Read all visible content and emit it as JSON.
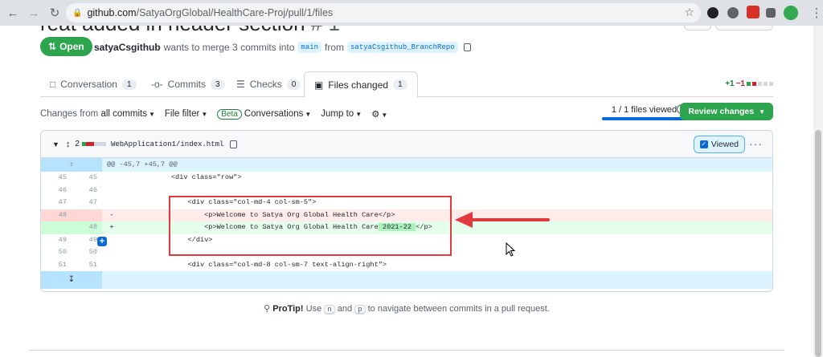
{
  "browser": {
    "url_host": "github.com",
    "url_path": "/SatyaOrgGlobal/HealthCare-Proj/pull/1/files"
  },
  "pr": {
    "title_fragment": "reat added in header section",
    "number_fragment": "# 1",
    "state": "Open",
    "author": "satyaCsgithub",
    "merge_text": "wants to merge 3 commits into",
    "base_branch": "main",
    "from_text": "from",
    "head_branch": "satyaCsgithub_BranchRepo"
  },
  "tabs": [
    {
      "label": "Conversation",
      "count": "1"
    },
    {
      "label": "Commits",
      "count": "3"
    },
    {
      "label": "Checks",
      "count": "0"
    },
    {
      "label": "Files changed",
      "count": "1"
    }
  ],
  "diffstat": {
    "add": "+1",
    "del": "−1"
  },
  "toolbar": {
    "changes_from_prefix": "Changes from",
    "changes_from_value": "all commits",
    "file_filter": "File filter",
    "beta": "Beta",
    "conversations": "Conversations",
    "jump_to": "Jump to",
    "files_viewed": "1 / 1 files viewed",
    "review_changes": "Review changes"
  },
  "file": {
    "changes": "2",
    "name": "WebApplication1/index.html",
    "viewed_label": "Viewed"
  },
  "diff": {
    "hunk": "@@ -45,7 +45,7 @@",
    "lines": [
      {
        "old": "45",
        "new": "45",
        "sign": "",
        "code": "            <div class=\"row\">",
        "type": "ctx"
      },
      {
        "old": "46",
        "new": "46",
        "sign": "",
        "code": "",
        "type": "ctx"
      },
      {
        "old": "47",
        "new": "47",
        "sign": "",
        "code": "                <div class=\"col-md-4 col-sm-5\">",
        "type": "ctx"
      },
      {
        "old": "48",
        "new": "",
        "sign": "-",
        "code": "                    <p>Welcome to Satya Org Global Health Care</p>",
        "type": "del"
      },
      {
        "old": "",
        "new": "48",
        "sign": "+",
        "code": "                    <p>Welcome to Satya Org Global Health Care",
        "hl": " 2021-22 ",
        "tail": "</p>",
        "type": "add"
      },
      {
        "old": "49",
        "new": "49",
        "sign": "",
        "code": "                </div>",
        "type": "ctx"
      },
      {
        "old": "50",
        "new": "50",
        "sign": "",
        "code": "",
        "type": "ctx"
      },
      {
        "old": "51",
        "new": "51",
        "sign": "",
        "code": "                <div class=\"col-md-8 col-sm-7 text-align-right\">",
        "type": "ctx"
      }
    ]
  },
  "protip": {
    "label": "ProTip!",
    "text1": "Use",
    "key_n": "n",
    "text2": "and",
    "key_p": "p",
    "text3": "to navigate between commits in a pull request."
  },
  "colors": {
    "green": "#2da44e",
    "annotation_red": "#e0393e",
    "link_blue": "#0969da"
  }
}
